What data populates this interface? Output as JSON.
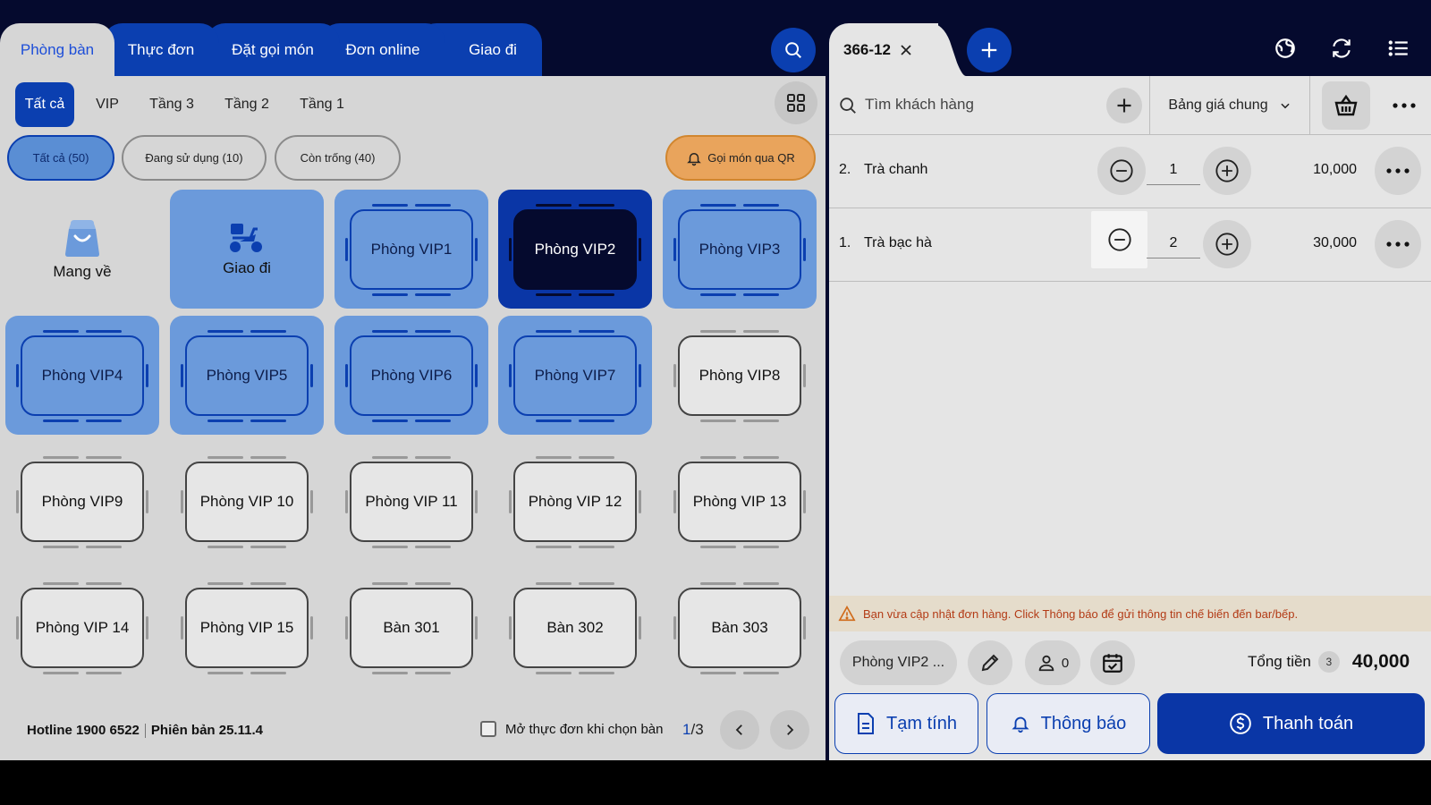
{
  "tabs": [
    {
      "label": "Phòng bàn"
    },
    {
      "label": "Thực đơn"
    },
    {
      "label": "Đặt gọi món"
    },
    {
      "label": "Đơn online"
    },
    {
      "label": "Giao đi"
    }
  ],
  "floors": [
    {
      "label": "Tất cả"
    },
    {
      "label": "VIP"
    },
    {
      "label": "Tầng 3"
    },
    {
      "label": "Tầng 2"
    },
    {
      "label": "Tầng 1"
    }
  ],
  "filters": [
    {
      "label": "Tất cả (50)"
    },
    {
      "label": "Đang sử dụng (10)"
    },
    {
      "label": "Còn trống (40)"
    }
  ],
  "qr_button": "Gọi món qua QR",
  "special": {
    "takeaway": "Mang về",
    "delivery": "Giao đi"
  },
  "rooms": [
    "Phòng VIP1",
    "Phòng VIP2",
    "Phòng VIP3",
    "Phòng VIP4",
    "Phòng VIP5",
    "Phòng VIP6",
    "Phòng VIP7",
    "Phòng VIP8",
    "Phòng VIP9",
    "Phòng VIP 10",
    "Phòng VIP 11",
    "Phòng VIP 12",
    "Phòng VIP 13",
    "Phòng VIP 14",
    "Phòng VIP 15",
    "Bàn 301",
    "Bàn 302",
    "Bàn 303"
  ],
  "footer": {
    "hotline": "Hotline 1900 6522",
    "version": "Phiên bản 25.11.4",
    "open_menu": "Mở thực đơn khi chọn bàn",
    "page_current": "1",
    "page_sep": "/",
    "page_total": "3"
  },
  "order": {
    "tab_label": "366-12",
    "search_placeholder": "Tìm khách hàng",
    "price_list": "Bảng giá chung",
    "items": [
      {
        "index": "2.",
        "name": "Trà chanh",
        "qty": "1",
        "price": "10,000"
      },
      {
        "index": "1.",
        "name": "Trà bạc hà",
        "qty": "2",
        "price": "30,000"
      }
    ],
    "notice": "Bạn vừa cập nhật đơn hàng. Click Thông báo để gửi thông tin chế biến đến bar/bếp.",
    "table_chip": "Phòng VIP2 ...",
    "guest_count": "0",
    "total_label": "Tổng tiền",
    "total_count": "3",
    "total_value": "40,000",
    "btn_temp": "Tạm tính",
    "btn_notify": "Thông báo",
    "btn_pay": "Thanh toán"
  },
  "colors": {
    "primary": "#0b3fb0",
    "dark": "#050a2e",
    "in_use": "#6b9adb",
    "qr": "#e9a45c",
    "warning": "#b33b16"
  }
}
